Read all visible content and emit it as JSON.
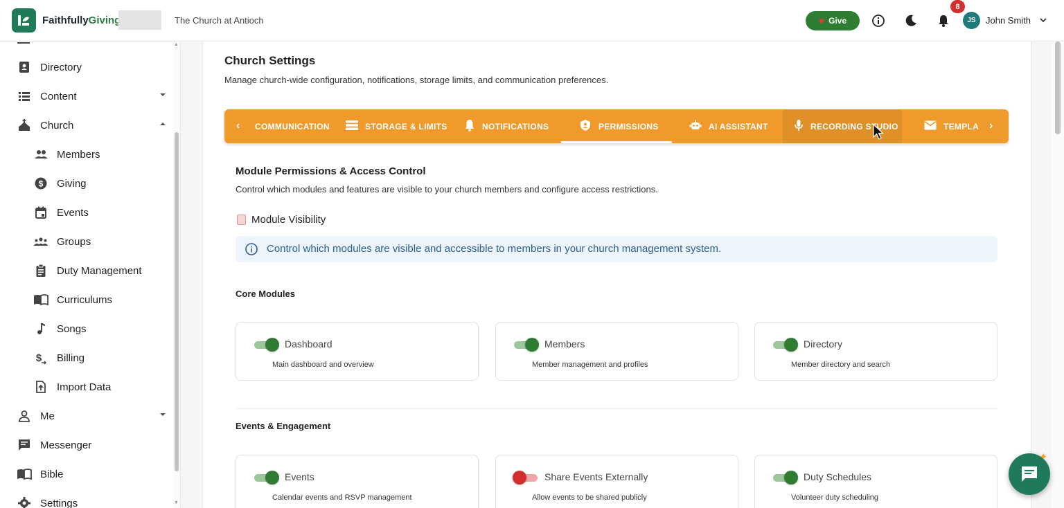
{
  "header": {
    "brand_part1": "Faithfully",
    "brand_part2": "Giving",
    "church_name": "The Church at Antioch",
    "give_label": "Give",
    "notification_count": "8",
    "user_initials": "JS",
    "user_name": "John Smith"
  },
  "sidebar": {
    "items": [
      {
        "label": "Directory",
        "icon": "contact-card-icon"
      },
      {
        "label": "Content",
        "icon": "list-icon",
        "expanded": false
      },
      {
        "label": "Church",
        "icon": "church-icon",
        "expanded": true
      },
      {
        "label": "Members",
        "icon": "people-icon"
      },
      {
        "label": "Giving",
        "icon": "dollar-circle-icon"
      },
      {
        "label": "Events",
        "icon": "calendar-icon"
      },
      {
        "label": "Groups",
        "icon": "groups-icon"
      },
      {
        "label": "Duty Management",
        "icon": "clipboard-icon"
      },
      {
        "label": "Curriculums",
        "icon": "book-open-icon"
      },
      {
        "label": "Songs",
        "icon": "music-note-icon"
      },
      {
        "label": "Billing",
        "icon": "currency-icon"
      },
      {
        "label": "Import Data",
        "icon": "file-upload-icon"
      },
      {
        "label": "Me",
        "icon": "person-icon",
        "expanded": false
      },
      {
        "label": "Messenger",
        "icon": "chat-icon"
      },
      {
        "label": "Bible",
        "icon": "book-icon"
      },
      {
        "label": "Settings",
        "icon": "gear-icon"
      }
    ]
  },
  "page": {
    "title": "Church Settings",
    "subtitle": "Manage church-wide configuration, notifications, storage limits, and communication preferences."
  },
  "tabs": [
    {
      "label": "COMMUNICATION",
      "icon": "none"
    },
    {
      "label": "STORAGE & LIMITS",
      "icon": "storage-icon"
    },
    {
      "label": "NOTIFICATIONS",
      "icon": "bell-icon"
    },
    {
      "label": "PERMISSIONS",
      "icon": "shield-icon",
      "active": true
    },
    {
      "label": "AI ASSISTANT",
      "icon": "robot-icon"
    },
    {
      "label": "RECORDING STUDIO",
      "icon": "microphone-icon"
    },
    {
      "label": "TEMPLA",
      "icon": "mail-icon"
    }
  ],
  "permissions": {
    "title": "Module Permissions & Access Control",
    "subtitle": "Control which modules and features are visible to your church members and configure access restrictions.",
    "module_visibility_title": "Module Visibility",
    "info_text": "Control which modules are visible and accessible to members in your church management system.",
    "groups": [
      {
        "title": "Core Modules",
        "modules": [
          {
            "name": "Dashboard",
            "description": "Main dashboard and overview",
            "enabled": true
          },
          {
            "name": "Members",
            "description": "Member management and profiles",
            "enabled": true
          },
          {
            "name": "Directory",
            "description": "Member directory and search",
            "enabled": true
          }
        ]
      },
      {
        "title": "Events & Engagement",
        "modules": [
          {
            "name": "Events",
            "description": "Calendar events and RSVP management",
            "enabled": true
          },
          {
            "name": "Share Events Externally",
            "description": "Allow events to be shared publicly",
            "enabled": false
          },
          {
            "name": "Duty Schedules",
            "description": "Volunteer duty scheduling",
            "enabled": true
          }
        ]
      }
    ]
  },
  "colors": {
    "tab_bar": "#ef9a2b",
    "brand_green": "#2e7d32",
    "toggle_off": "#d32f2f",
    "info_text": "#2a5d93"
  }
}
